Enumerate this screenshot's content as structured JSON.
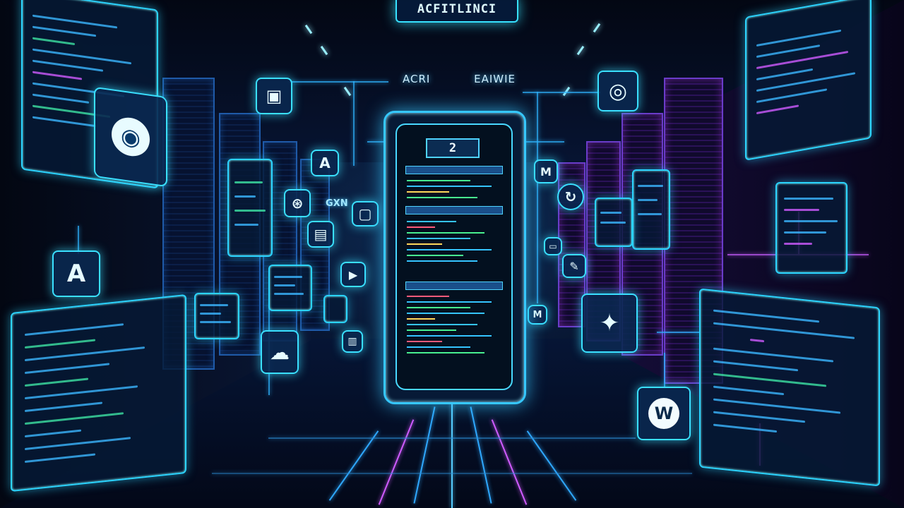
{
  "scene": {
    "sign_top": "ACFITLINCI",
    "sign_sub_left": "ACRI",
    "sign_sub_right": "EAIWIE",
    "floating_label": "GXN",
    "device_counter": "2"
  },
  "icons": [
    {
      "name": "clipboard-icon",
      "glyph": "▣"
    },
    {
      "name": "network-circle-icon",
      "glyph": "◉"
    },
    {
      "name": "letter-a-icon-small",
      "glyph": "A"
    },
    {
      "name": "globe-icon",
      "glyph": "⊛"
    },
    {
      "name": "frame-icon",
      "glyph": "▢"
    },
    {
      "name": "folder-icon",
      "glyph": "▤"
    },
    {
      "name": "letter-a-icon-large",
      "glyph": "A"
    },
    {
      "name": "media-icon",
      "glyph": "▶"
    },
    {
      "name": "cloud-icon",
      "glyph": "☁"
    },
    {
      "name": "chart-icon",
      "glyph": "▥"
    },
    {
      "name": "swirl-icon",
      "glyph": "◎"
    },
    {
      "name": "letter-m-icon",
      "glyph": "M"
    },
    {
      "name": "refresh-icon",
      "glyph": "↻"
    },
    {
      "name": "box-icon",
      "glyph": "▭"
    },
    {
      "name": "tag-icon",
      "glyph": "✎"
    },
    {
      "name": "letter-m-icon-small",
      "glyph": "M"
    },
    {
      "name": "star-icon",
      "glyph": "✦"
    },
    {
      "name": "letter-w-icon",
      "glyph": "W"
    }
  ],
  "colors": {
    "accent_cyan": "#2bd4ff",
    "accent_purple": "#c95cff",
    "background": "#050a1a"
  }
}
